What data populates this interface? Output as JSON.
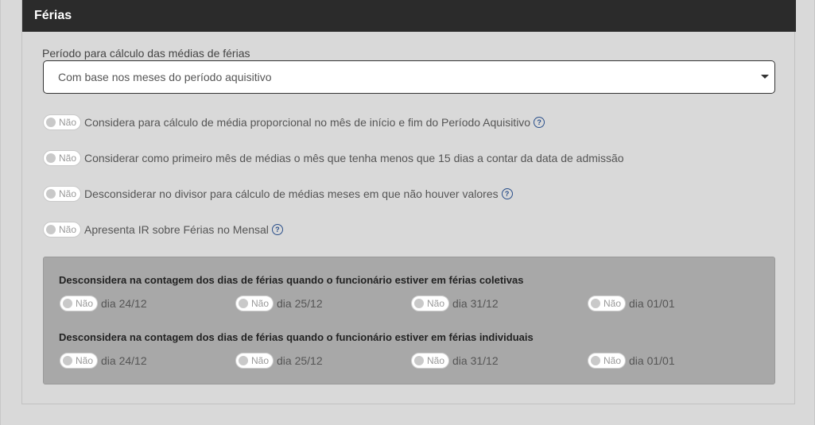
{
  "panel": {
    "title": "Férias"
  },
  "period": {
    "label": "Período para cálculo das médias de férias",
    "selected": "Com base nos meses do período aquisitivo"
  },
  "options": [
    {
      "state": "Não",
      "text": "Considera para cálculo de média proporcional no mês de início e fim do Período Aquisitivo",
      "help": true
    },
    {
      "state": "Não",
      "text": "Considerar como primeiro mês de médias o mês que tenha menos que 15 dias a contar da data de admissão",
      "help": false
    },
    {
      "state": "Não",
      "text": "Desconsiderar no divisor para cálculo de médias meses em que não houver valores",
      "help": true
    },
    {
      "state": "Não",
      "text": "Apresenta IR sobre Férias no Mensal",
      "help": true
    }
  ],
  "help_icon_glyph": "?",
  "groups": [
    {
      "title": "Desconsidera na contagem dos dias de férias quando o funcionário estiver em férias coletivas",
      "days": [
        {
          "state": "Não",
          "label": "dia 24/12"
        },
        {
          "state": "Não",
          "label": "dia 25/12"
        },
        {
          "state": "Não",
          "label": "dia 31/12"
        },
        {
          "state": "Não",
          "label": "dia 01/01"
        }
      ]
    },
    {
      "title": "Desconsidera na contagem dos dias de férias quando o funcionário estiver em férias individuais",
      "days": [
        {
          "state": "Não",
          "label": "dia 24/12"
        },
        {
          "state": "Não",
          "label": "dia 25/12"
        },
        {
          "state": "Não",
          "label": "dia 31/12"
        },
        {
          "state": "Não",
          "label": "dia 01/01"
        }
      ]
    }
  ]
}
